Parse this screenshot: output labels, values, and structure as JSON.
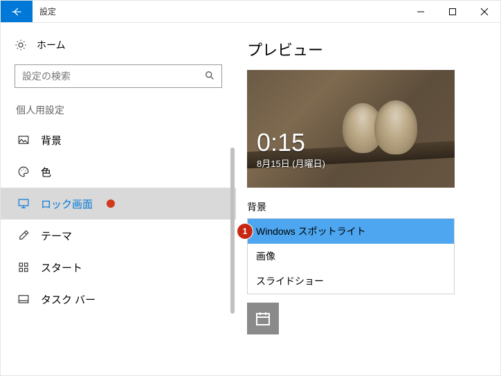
{
  "window": {
    "title": "設定"
  },
  "sidebar": {
    "home": "ホーム",
    "search_placeholder": "設定の検索",
    "section_label": "個人用設定",
    "items": [
      {
        "label": "背景"
      },
      {
        "label": "色"
      },
      {
        "label": "ロック画面"
      },
      {
        "label": "テーマ"
      },
      {
        "label": "スタート"
      },
      {
        "label": "タスク バー"
      }
    ]
  },
  "content": {
    "preview_heading": "プレビュー",
    "lock_time": "0:15",
    "lock_date": "8月15日 (月曜日)",
    "background_label": "背景",
    "dropdown": {
      "selected_index": 0,
      "options": [
        "Windows スポットライト",
        "画像",
        "スライドショー"
      ]
    },
    "annotation_number": "1"
  },
  "colors": {
    "accent": "#0078d7",
    "dropdown_highlight": "#4da6ef",
    "marker": "#c82812"
  }
}
